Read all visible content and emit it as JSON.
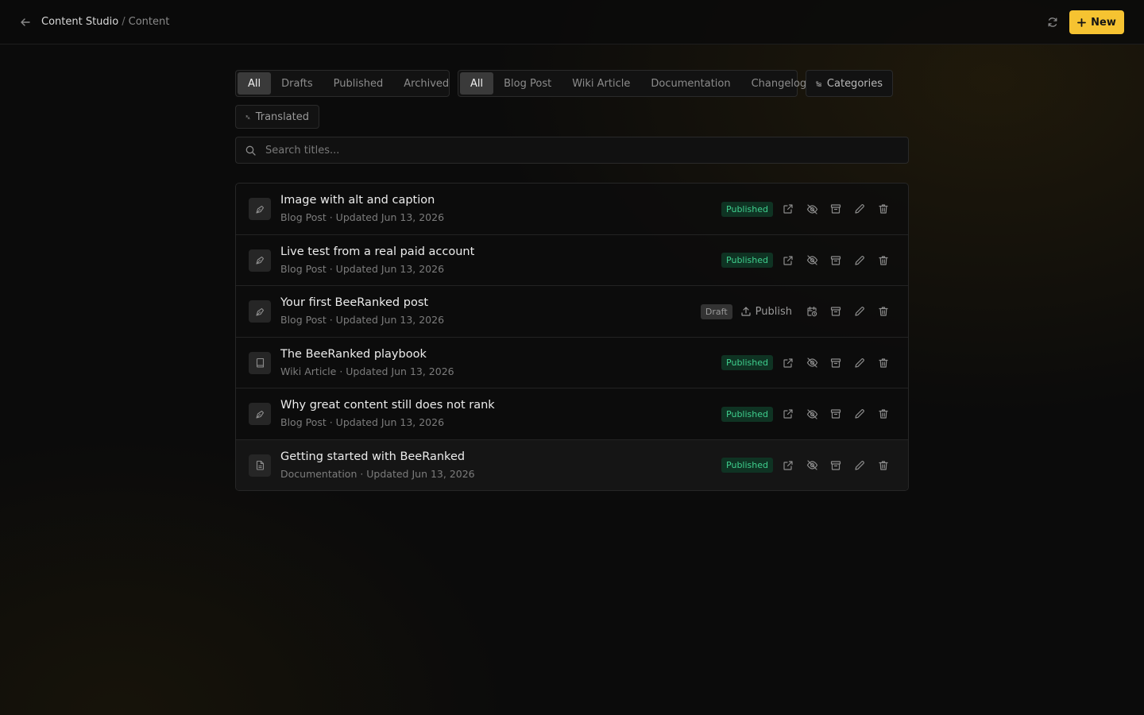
{
  "header": {
    "breadcrumb_root": "Content Studio",
    "breadcrumb_sep": "/",
    "breadcrumb_current": "Content",
    "new_label": "New",
    "accent": "#f6c331"
  },
  "status_filter": {
    "options": [
      "All",
      "Drafts",
      "Published",
      "Archived"
    ],
    "selected": "All"
  },
  "type_filter": {
    "options": [
      "All",
      "Blog Post",
      "Wiki Article",
      "Documentation",
      "Changelog"
    ],
    "selected": "All"
  },
  "categories_label": "Categories",
  "translated_label": "Translated",
  "search": {
    "placeholder": "Search titles...",
    "value": ""
  },
  "items": [
    {
      "title": "Image with alt and caption",
      "meta": "Blog Post · Updated Jun 13, 2026",
      "type_icon": "pen-nib-icon",
      "status": "Published"
    },
    {
      "title": "Live test from a real paid account",
      "meta": "Blog Post · Updated Jun 13, 2026",
      "type_icon": "pen-nib-icon",
      "status": "Published"
    },
    {
      "title": "Your first BeeRanked post",
      "meta": "Blog Post · Updated Jun 13, 2026",
      "type_icon": "pen-nib-icon",
      "status": "Draft",
      "publish_label": "Publish"
    },
    {
      "title": "The BeeRanked playbook",
      "meta": "Wiki Article · Updated Jun 13, 2026",
      "type_icon": "book-icon",
      "status": "Published"
    },
    {
      "title": "Why great content still does not rank",
      "meta": "Blog Post · Updated Jun 13, 2026",
      "type_icon": "pen-nib-icon",
      "status": "Published"
    },
    {
      "title": "Getting started with BeeRanked",
      "meta": "Documentation · Updated Jun 13, 2026",
      "type_icon": "file-icon",
      "status": "Published"
    }
  ],
  "colors": {
    "published_bg": "#0f3323",
    "published_text": "#3fcf8e",
    "draft_bg": "#333333"
  }
}
